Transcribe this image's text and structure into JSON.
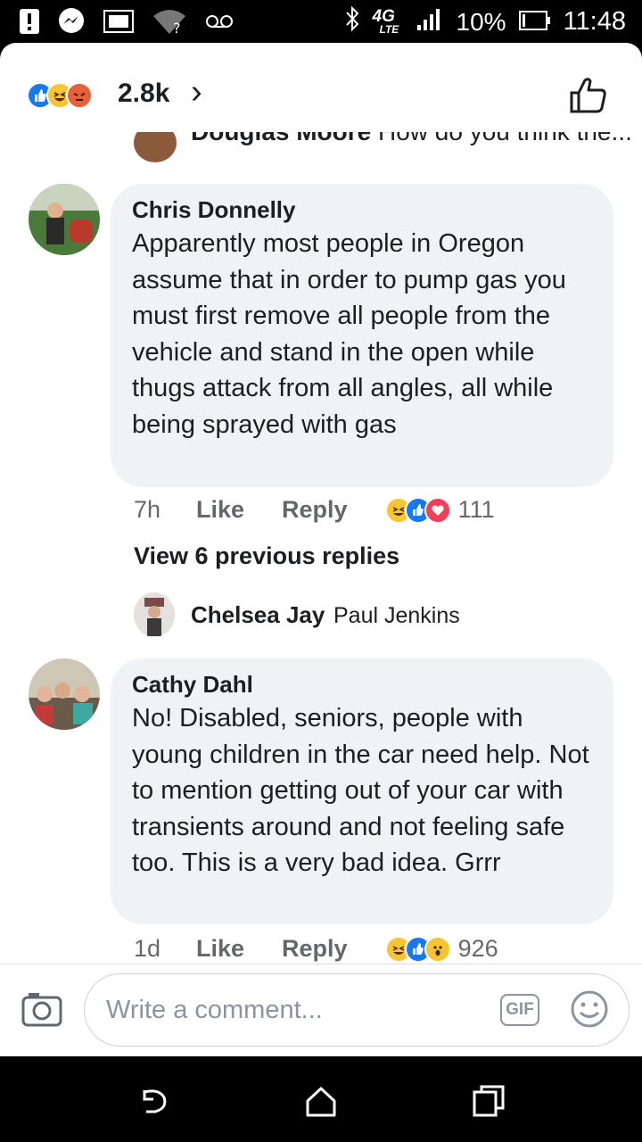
{
  "status_bar": {
    "icons": [
      "alert-icon",
      "messenger-icon",
      "image-icon",
      "wifi-unknown-icon",
      "voicemail-icon",
      "bluetooth-icon",
      "lte-icon",
      "signal-icon",
      "battery-icon"
    ],
    "network": "4G",
    "network_sub": "LTE",
    "battery": "10%",
    "time": "11:48"
  },
  "reactions_bar": {
    "icons": [
      "like-icon",
      "haha-icon",
      "angry-icon"
    ],
    "count": "2.8k",
    "chevron": "›"
  },
  "partial_comment": {
    "author": "Douglas Moore",
    "text": "How do you think the..."
  },
  "comments": [
    {
      "author": "Chris Donnelly",
      "text": "Apparently most people in Oregon assume that in order to pump gas you must first remove all people from the vehicle and stand in the open while thugs attack from all angles, all while being sprayed with gas",
      "time": "7h",
      "like": "Like",
      "reply": "Reply",
      "reactions": [
        "haha-icon",
        "like-icon",
        "love-icon"
      ],
      "reaction_count": "111"
    },
    {
      "author": "Cathy Dahl",
      "text": "No! Disabled, seniors, people with young children in the car need help. Not to mention getting out of your car with transients around and not feeling safe too. This is a very bad idea. Grrr",
      "time": "1d",
      "like": "Like",
      "reply": "Reply",
      "reactions": [
        "haha-icon",
        "like-icon",
        "wow-icon"
      ],
      "reaction_count": "926"
    }
  ],
  "view_previous": "View 6 previous replies",
  "reply_preview": {
    "author": "Chelsea Jay",
    "tag": "Paul Jenkins"
  },
  "composer": {
    "placeholder": "Write a comment...",
    "gif_label": "GIF"
  },
  "colors": {
    "accent": "#1877f2",
    "bubble": "#f0f2f5",
    "muted": "#65676b"
  }
}
